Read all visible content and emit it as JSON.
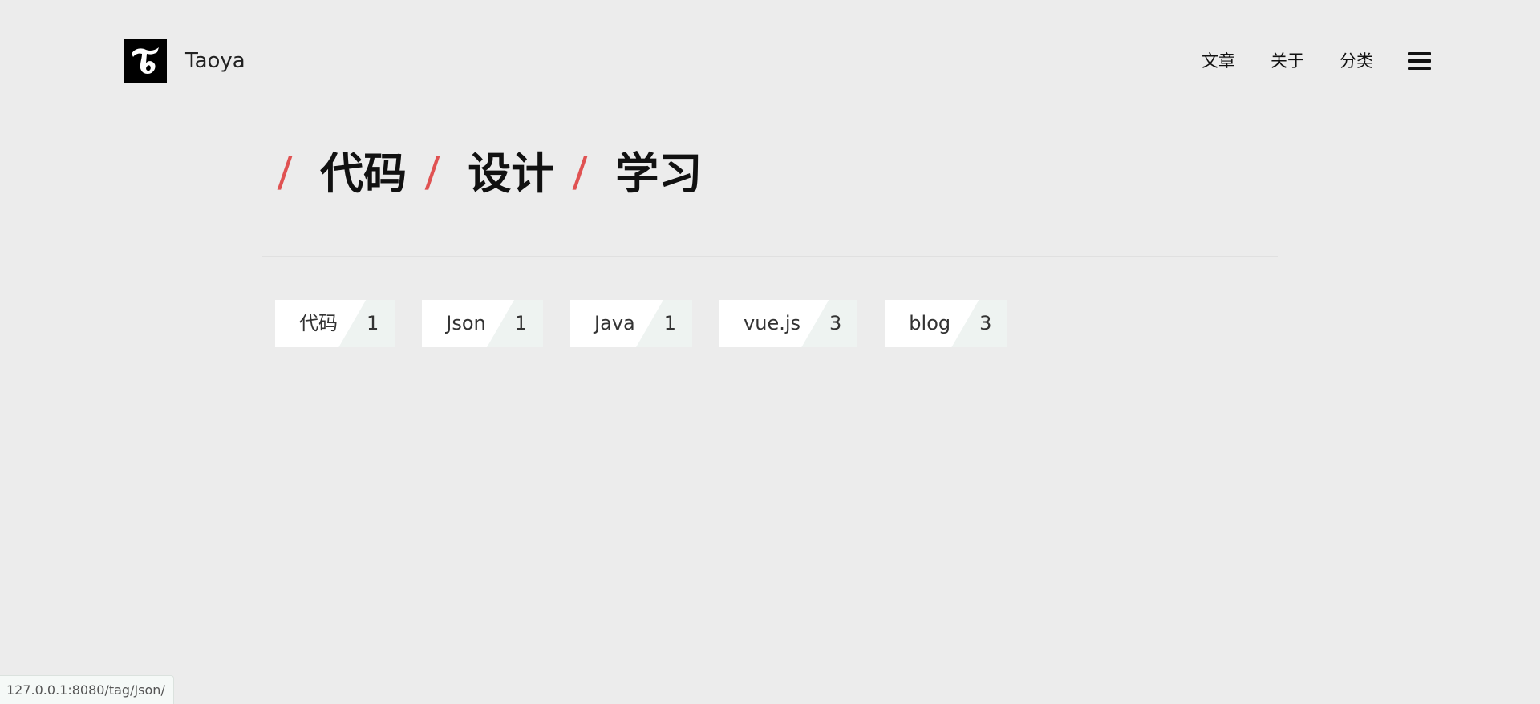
{
  "site": {
    "name": "Taoya",
    "logo_glyph": "T"
  },
  "nav": {
    "items": [
      "文章",
      "关于",
      "分类"
    ],
    "menu_icon": "hamburger-menu-icon"
  },
  "categories": {
    "separator": "/",
    "items": [
      "代码",
      "设计",
      "学习"
    ]
  },
  "tags": [
    {
      "label": "代码",
      "count": "1"
    },
    {
      "label": "Json",
      "count": "1"
    },
    {
      "label": "Java",
      "count": "1"
    },
    {
      "label": "vue.js",
      "count": "3"
    },
    {
      "label": "blog",
      "count": "3"
    }
  ],
  "status_bar": {
    "url": "127.0.0.1:8080/tag/Json/"
  },
  "colors": {
    "background": "#ececec",
    "accent_slash": "#e05252",
    "tag_bg": "#ffffff",
    "tag_count_bg": "#eef3f1"
  }
}
